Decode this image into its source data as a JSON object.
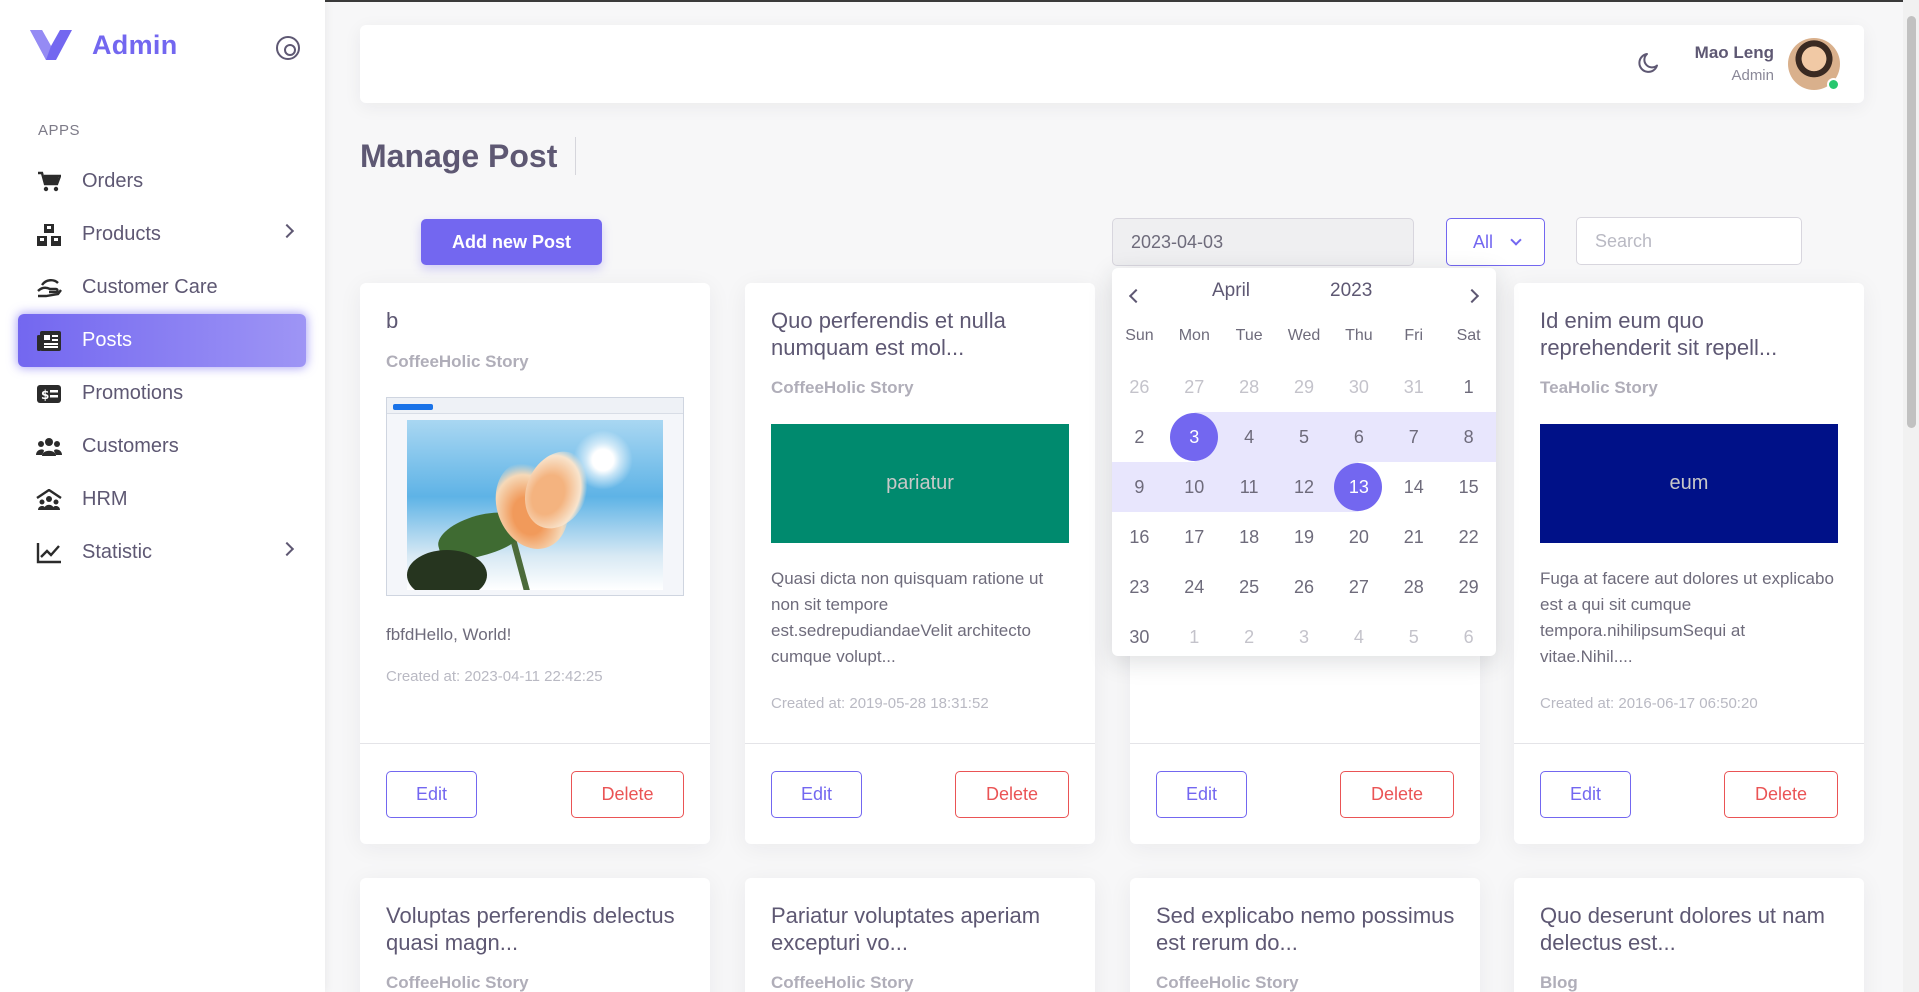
{
  "brand": {
    "name": "Admin",
    "color": "#7367f0"
  },
  "sidebar": {
    "section_label": "APPS",
    "items": [
      {
        "label": "Orders",
        "icon": "cart-icon",
        "has_children": false,
        "active": false
      },
      {
        "label": "Products",
        "icon": "boxes-icon",
        "has_children": true,
        "active": false
      },
      {
        "label": "Customer Care",
        "icon": "hand-care-icon",
        "has_children": false,
        "active": false
      },
      {
        "label": "Posts",
        "icon": "newspaper-icon",
        "has_children": false,
        "active": true
      },
      {
        "label": "Promotions",
        "icon": "money-bill-icon",
        "has_children": false,
        "active": false
      },
      {
        "label": "Customers",
        "icon": "users-icon",
        "has_children": false,
        "active": false
      },
      {
        "label": "HRM",
        "icon": "people-roof-icon",
        "has_children": false,
        "active": false
      },
      {
        "label": "Statistic",
        "icon": "chart-line-icon",
        "has_children": true,
        "active": false
      }
    ]
  },
  "header": {
    "theme_icon": "moon-icon",
    "user_name": "Mao Leng",
    "user_role": "Admin",
    "status_color": "#28c76f"
  },
  "page": {
    "title": "Manage Post"
  },
  "toolbar": {
    "add_label": "Add new Post",
    "date_value": "2023-04-03",
    "filter_value": "All",
    "search_placeholder": "Search"
  },
  "calendar": {
    "month": "April",
    "year": "2023",
    "weekdays": [
      "Sun",
      "Mon",
      "Tue",
      "Wed",
      "Thu",
      "Fri",
      "Sat"
    ],
    "weeks": [
      [
        "26",
        "27",
        "28",
        "29",
        "30",
        "31",
        "1"
      ],
      [
        "2",
        "3",
        "4",
        "5",
        "6",
        "7",
        "8"
      ],
      [
        "9",
        "10",
        "11",
        "12",
        "13",
        "14",
        "15"
      ],
      [
        "16",
        "17",
        "18",
        "19",
        "20",
        "21",
        "22"
      ],
      [
        "23",
        "24",
        "25",
        "26",
        "27",
        "28",
        "29"
      ],
      [
        "30",
        "1",
        "2",
        "3",
        "4",
        "5",
        "6"
      ]
    ],
    "range_start": "3",
    "range_end": "13"
  },
  "posts": [
    {
      "title": "b",
      "author": "CoffeeHolic Story",
      "media": "photo",
      "body": "fbfdHello, World!",
      "created": "Created at: 2023-04-11 22:42:25",
      "edit_label": "Edit",
      "delete_label": "Delete"
    },
    {
      "title": "Quo perferendis et nulla numquam est mol...",
      "author": "CoffeeHolic Story",
      "media_text": "pariatur",
      "media_color": "#008a6e",
      "body": "Quasi dicta non quisquam ratione ut non sit tempore est.sedrepudiandaeVelit architecto cumque volupt...",
      "created": "Created at: 2019-05-28 18:31:52",
      "edit_label": "Edit",
      "delete_label": "Delete"
    },
    {
      "edit_label": "Edit",
      "delete_label": "Delete"
    },
    {
      "title": "Id enim eum quo reprehenderit sit repell...",
      "author": "TeaHolic Story",
      "media_text": "eum",
      "media_color": "#001188",
      "body": "Fuga at facere aut dolores ut explicabo est a qui sit cumque tempora.nihilipsumSequi at vitae.Nihil....",
      "created": "Created at: 2016-06-17 06:50:20",
      "edit_label": "Edit",
      "delete_label": "Delete"
    }
  ],
  "posts_row2": [
    {
      "title": "Voluptas perferendis delectus quasi magn...",
      "author": "CoffeeHolic Story"
    },
    {
      "title": "Pariatur voluptates aperiam excepturi vo...",
      "author": "CoffeeHolic Story"
    },
    {
      "title": "Sed explicabo nemo possimus est rerum do...",
      "author": "CoffeeHolic Story"
    },
    {
      "title": "Quo deserunt dolores ut nam delectus est...",
      "author": "Blog"
    }
  ]
}
